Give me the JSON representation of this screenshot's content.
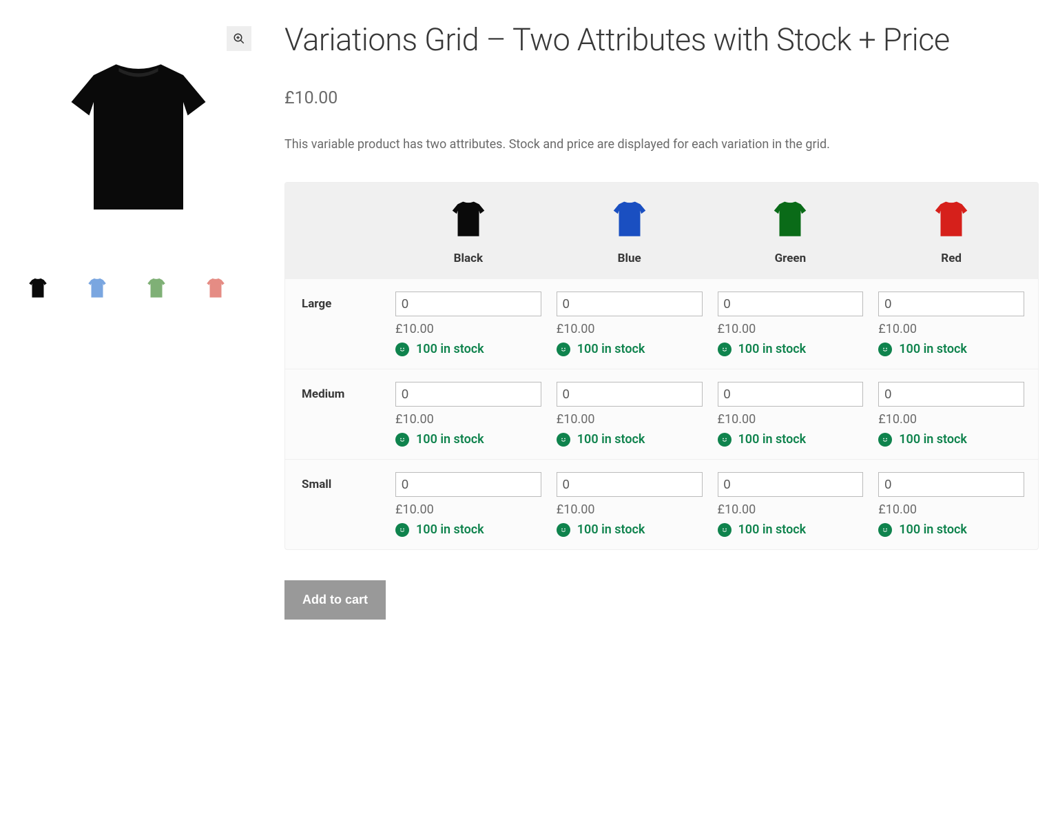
{
  "product": {
    "title": "Variations Grid – Two Attributes with Stock + Price",
    "price": "£10.00",
    "description": "This variable product has two attributes. Stock and price are displayed for each variation in the grid.",
    "main_image_color": "#0a0a0a"
  },
  "gallery_thumbs": [
    {
      "color": "#0a0a0a"
    },
    {
      "color": "#7aa6e0"
    },
    {
      "color": "#7fb076"
    },
    {
      "color": "#e58c84"
    }
  ],
  "grid": {
    "colors": [
      {
        "label": "Black",
        "hex": "#0a0a0a"
      },
      {
        "label": "Blue",
        "hex": "#1a4fc1"
      },
      {
        "label": "Green",
        "hex": "#0a6b18"
      },
      {
        "label": "Red",
        "hex": "#d6201b"
      }
    ],
    "sizes": [
      "Large",
      "Medium",
      "Small"
    ],
    "cell": {
      "qty": "0",
      "price": "£10.00",
      "stock": "100 in stock"
    }
  },
  "buttons": {
    "add_to_cart": "Add to cart"
  },
  "icons": {
    "zoom": "zoom-in-icon"
  },
  "theme": {
    "stock_green": "#0f834d"
  }
}
